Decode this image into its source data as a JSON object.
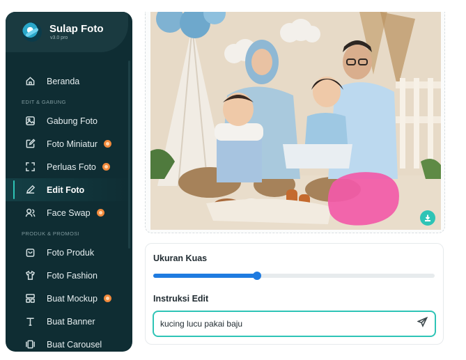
{
  "brand": {
    "name": "Sulap Foto",
    "version": "v3.0 pro"
  },
  "sidebar": {
    "home": {
      "label": "Beranda",
      "icon": "home-icon"
    },
    "section_edit": "EDIT & GABUNG",
    "edit_items": [
      {
        "label": "Gabung Foto",
        "icon": "image-icon",
        "badge": false
      },
      {
        "label": "Foto Miniatur",
        "icon": "edit-square-icon",
        "badge": true
      },
      {
        "label": "Perluas Foto",
        "icon": "expand-icon",
        "badge": true
      },
      {
        "label": "Edit Foto",
        "icon": "pencil-icon",
        "badge": false,
        "active": true
      },
      {
        "label": "Face Swap",
        "icon": "face-swap-icon",
        "badge": true
      }
    ],
    "section_product": "PRODUK & PROMOSI",
    "product_items": [
      {
        "label": "Foto Produk",
        "icon": "bag-icon",
        "badge": false
      },
      {
        "label": "Foto Fashion",
        "icon": "shirt-icon",
        "badge": false
      },
      {
        "label": "Buat Mockup",
        "icon": "mockup-icon",
        "badge": true
      },
      {
        "label": "Buat Banner",
        "icon": "text-t-icon",
        "badge": false
      },
      {
        "label": "Buat Carousel",
        "icon": "carousel-icon",
        "badge": false
      }
    ]
  },
  "editor": {
    "brush_label": "Ukuran Kuas",
    "brush_value": 0.37,
    "instruction_label": "Instruksi Edit",
    "instruction_value": "kucing lucu pakai baju"
  },
  "colors": {
    "sidebar_bg": "#0f2d33",
    "accent": "#2ec4b6",
    "slider": "#1f7be0",
    "badge": "#f28a3c",
    "mask": "#f25aa8"
  }
}
